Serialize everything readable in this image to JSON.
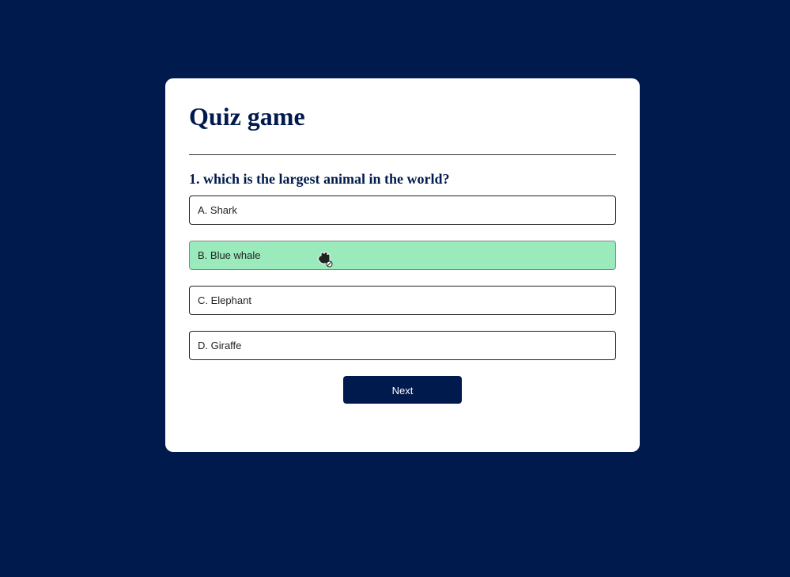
{
  "app": {
    "title": "Quiz game"
  },
  "question": {
    "text": "1. which is the largest animal in the world?"
  },
  "answers": [
    {
      "label": "A. Shark",
      "state": "default"
    },
    {
      "label": "B. Blue whale",
      "state": "correct"
    },
    {
      "label": "C. Elephant",
      "state": "default"
    },
    {
      "label": "D. Giraffe",
      "state": "default"
    }
  ],
  "controls": {
    "next_label": "Next"
  },
  "colors": {
    "background": "#001a4d",
    "card": "#ffffff",
    "correct": "#9aeabc",
    "primary": "#001a4d"
  },
  "cursor": {
    "icon": "grab-hand-not-allowed-icon"
  }
}
